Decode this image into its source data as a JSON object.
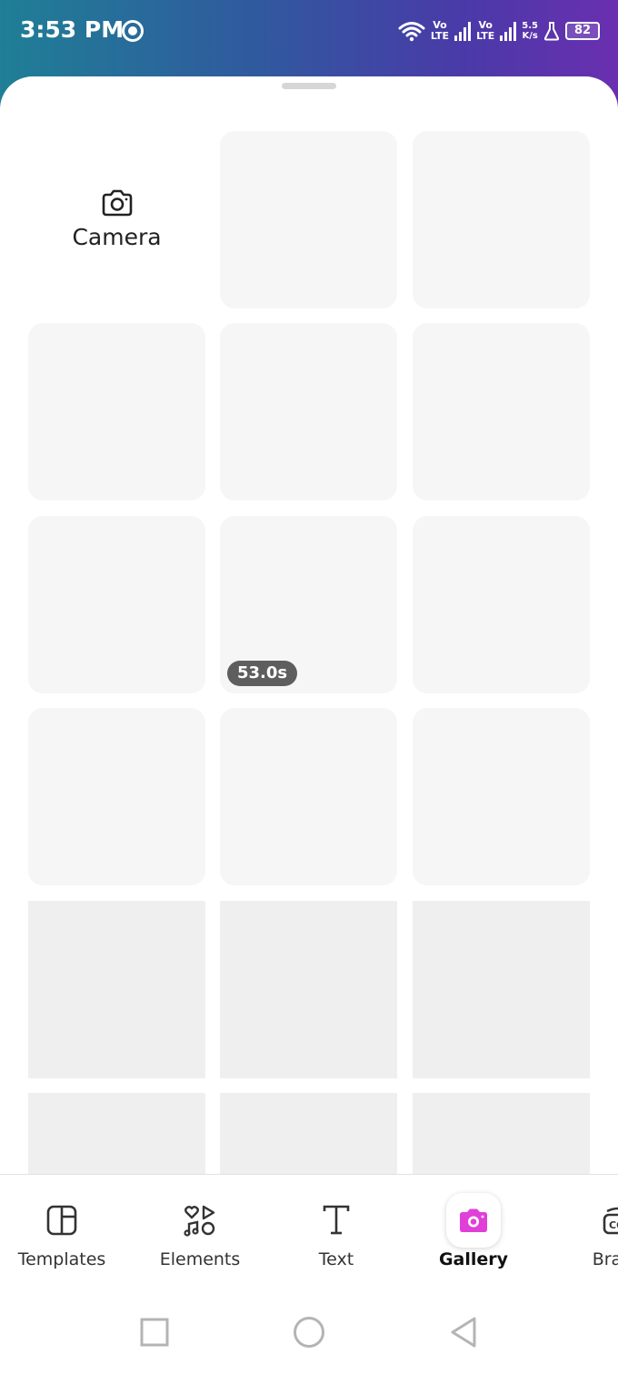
{
  "status_bar": {
    "time": "3:53 PM",
    "sim1_top": "Vo",
    "sim1_bottom": "LTE",
    "sim2_top": "Vo",
    "sim2_bottom": "LTE",
    "speed_value": "5.5",
    "speed_unit": "K/s",
    "battery": "82"
  },
  "gallery": {
    "camera_label": "Camera",
    "video_duration": "53.0s"
  },
  "tabs": [
    {
      "label": "Templates",
      "icon": "templates-icon"
    },
    {
      "label": "Elements",
      "icon": "elements-icon"
    },
    {
      "label": "Text",
      "icon": "text-icon"
    },
    {
      "label": "Gallery",
      "icon": "camera-icon",
      "active": true
    },
    {
      "label": "Brand",
      "icon": "brand-icon"
    }
  ],
  "colors": {
    "accent": "#e040d8",
    "tile": "#f6f6f6",
    "status_gradient": [
      "#1f7f96",
      "#6a2fb0"
    ]
  }
}
